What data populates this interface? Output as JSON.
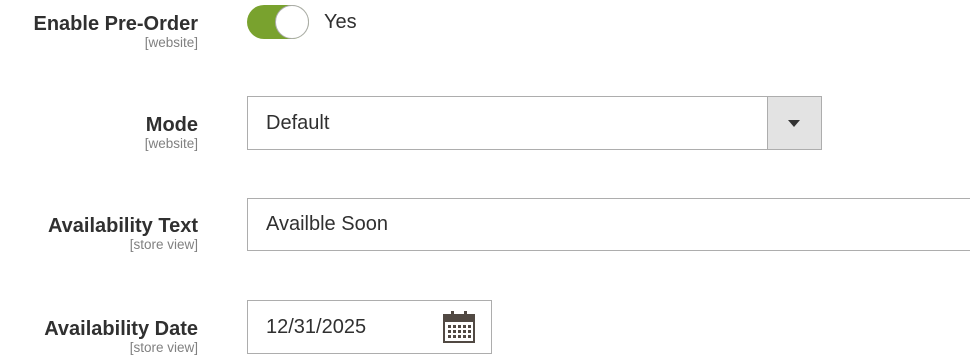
{
  "fields": {
    "enable_preorder": {
      "label": "Enable Pre-Order",
      "scope": "[website]",
      "toggle_state_text": "Yes",
      "enabled": true
    },
    "mode": {
      "label": "Mode",
      "scope": "[website]",
      "selected": "Default"
    },
    "availability_text": {
      "label": "Availability Text",
      "scope": "[store view]",
      "value": "Availble Soon"
    },
    "availability_date": {
      "label": "Availability Date",
      "scope": "[store view]",
      "value": "12/31/2025"
    }
  },
  "colors": {
    "toggle_on": "#79a22e",
    "border": "#adadad",
    "select_arrow_bg": "#e3e3e3"
  },
  "icons": {
    "select_arrow": "chevron-down-icon",
    "calendar": "calendar-icon"
  }
}
